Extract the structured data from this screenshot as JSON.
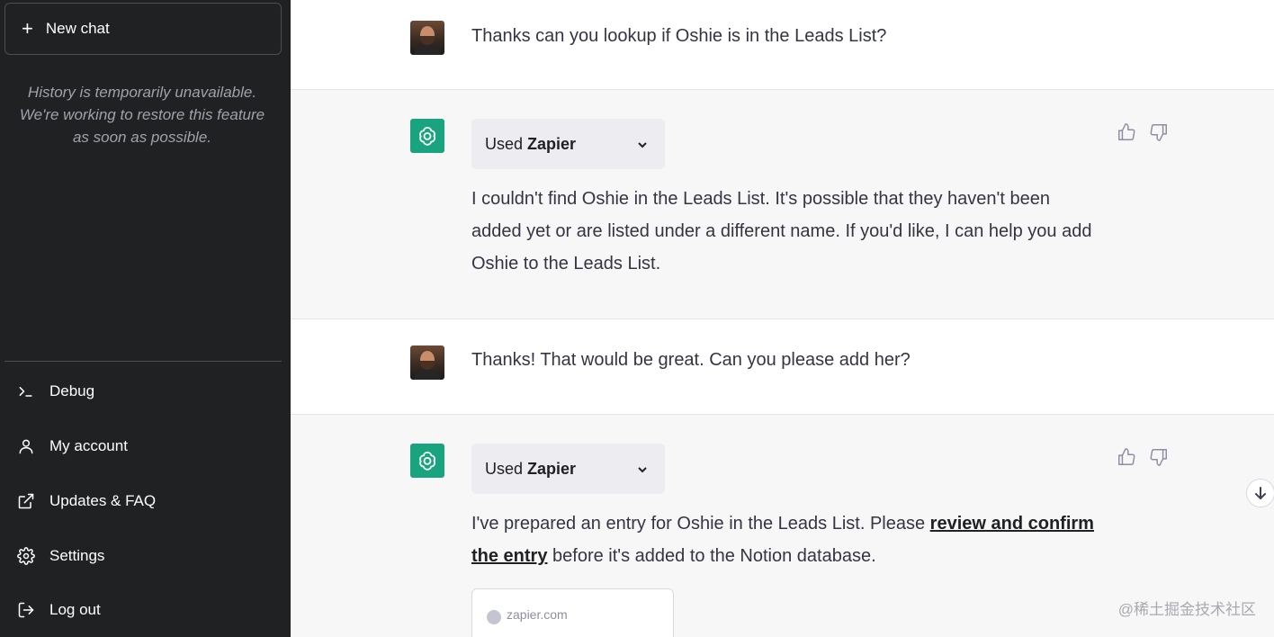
{
  "sidebar": {
    "new_chat_label": "New chat",
    "history_note": "History is temporarily unavailable. We're working to restore this feature as soon as possible.",
    "items": [
      {
        "label": "Debug",
        "icon": "terminal-icon"
      },
      {
        "label": "My account",
        "icon": "user-icon"
      },
      {
        "label": "Updates & FAQ",
        "icon": "external-link-icon"
      },
      {
        "label": "Settings",
        "icon": "gear-icon"
      },
      {
        "label": "Log out",
        "icon": "logout-icon"
      }
    ]
  },
  "conversation": [
    {
      "role": "user",
      "text": "Thanks can you lookup if Oshie is in the Leads List?"
    },
    {
      "role": "assistant",
      "plugin_prefix": "Used",
      "plugin_name": "Zapier",
      "text": "I couldn't find Oshie in the Leads List. It's possible that they haven't been added yet or are listed under a different name. If you'd like, I can help you add Oshie to the Leads List."
    },
    {
      "role": "user",
      "text": "Thanks! That would be great. Can you please add her?"
    },
    {
      "role": "assistant",
      "plugin_prefix": "Used",
      "plugin_name": "Zapier",
      "text_before": "I've prepared an entry for Oshie in the Leads List. Please ",
      "link_text": "review and confirm the entry",
      "text_after": " before it's added to the Notion database.",
      "link_card_domain": "zapier.com"
    }
  ],
  "watermark": "@稀土掘金技术社区",
  "colors": {
    "sidebar_bg": "#202123",
    "assistant_bg": "#f7f7f8",
    "assistant_avatar": "#19a37f"
  }
}
